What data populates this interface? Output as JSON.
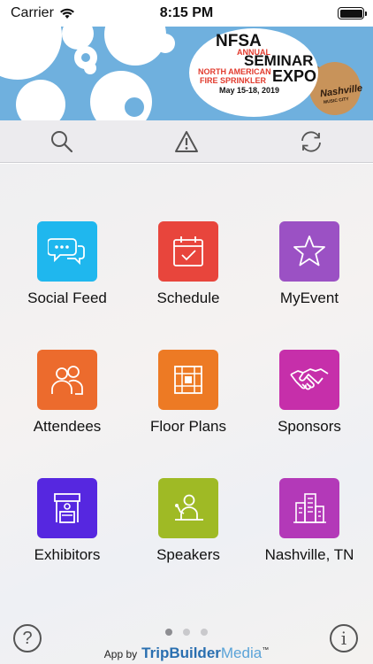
{
  "status_bar": {
    "carrier": "Carrier",
    "time": "8:15 PM"
  },
  "banner": {
    "org": "NFSA",
    "annual": "ANNUAL",
    "seminar": "SEMINAR",
    "expo": "EXPO",
    "sub1": "NORTH AMERICAN",
    "sub2": "FIRE SPRINKLER",
    "dates": "May 15-18, 2019",
    "city_logo": "Nashville",
    "city_tag": "MUSIC CITY"
  },
  "toolbar": {
    "icons": [
      "search-icon",
      "alert-icon",
      "refresh-icon"
    ]
  },
  "tiles": [
    {
      "label": "Social Feed",
      "color": "#1fb7ee",
      "icon": "chat-bubbles-icon"
    },
    {
      "label": "Schedule",
      "color": "#e8453c",
      "icon": "calendar-check-icon"
    },
    {
      "label": "MyEvent",
      "color": "#9b51c4",
      "icon": "star-icon"
    },
    {
      "label": "Attendees",
      "color": "#ec6b2d",
      "icon": "people-icon"
    },
    {
      "label": "Floor Plans",
      "color": "#ed7a24",
      "icon": "floor-plan-icon"
    },
    {
      "label": "Sponsors",
      "color": "#c62faa",
      "icon": "handshake-icon"
    },
    {
      "label": "Exhibitors",
      "color": "#5627e0",
      "icon": "booth-icon"
    },
    {
      "label": "Speakers",
      "color": "#9fba25",
      "icon": "speaker-icon"
    },
    {
      "label": "Nashville, TN",
      "color": "#b339b8",
      "icon": "city-icon"
    }
  ],
  "pager": {
    "pages": 3,
    "current": 1
  },
  "footer": {
    "prefix": "App by",
    "brand_trip": "TripBuilder",
    "brand_media": "Media",
    "trademark": "™"
  },
  "colors": {
    "banner_bg": "#6fb0de",
    "toolbar_bg": "#ecebee"
  }
}
